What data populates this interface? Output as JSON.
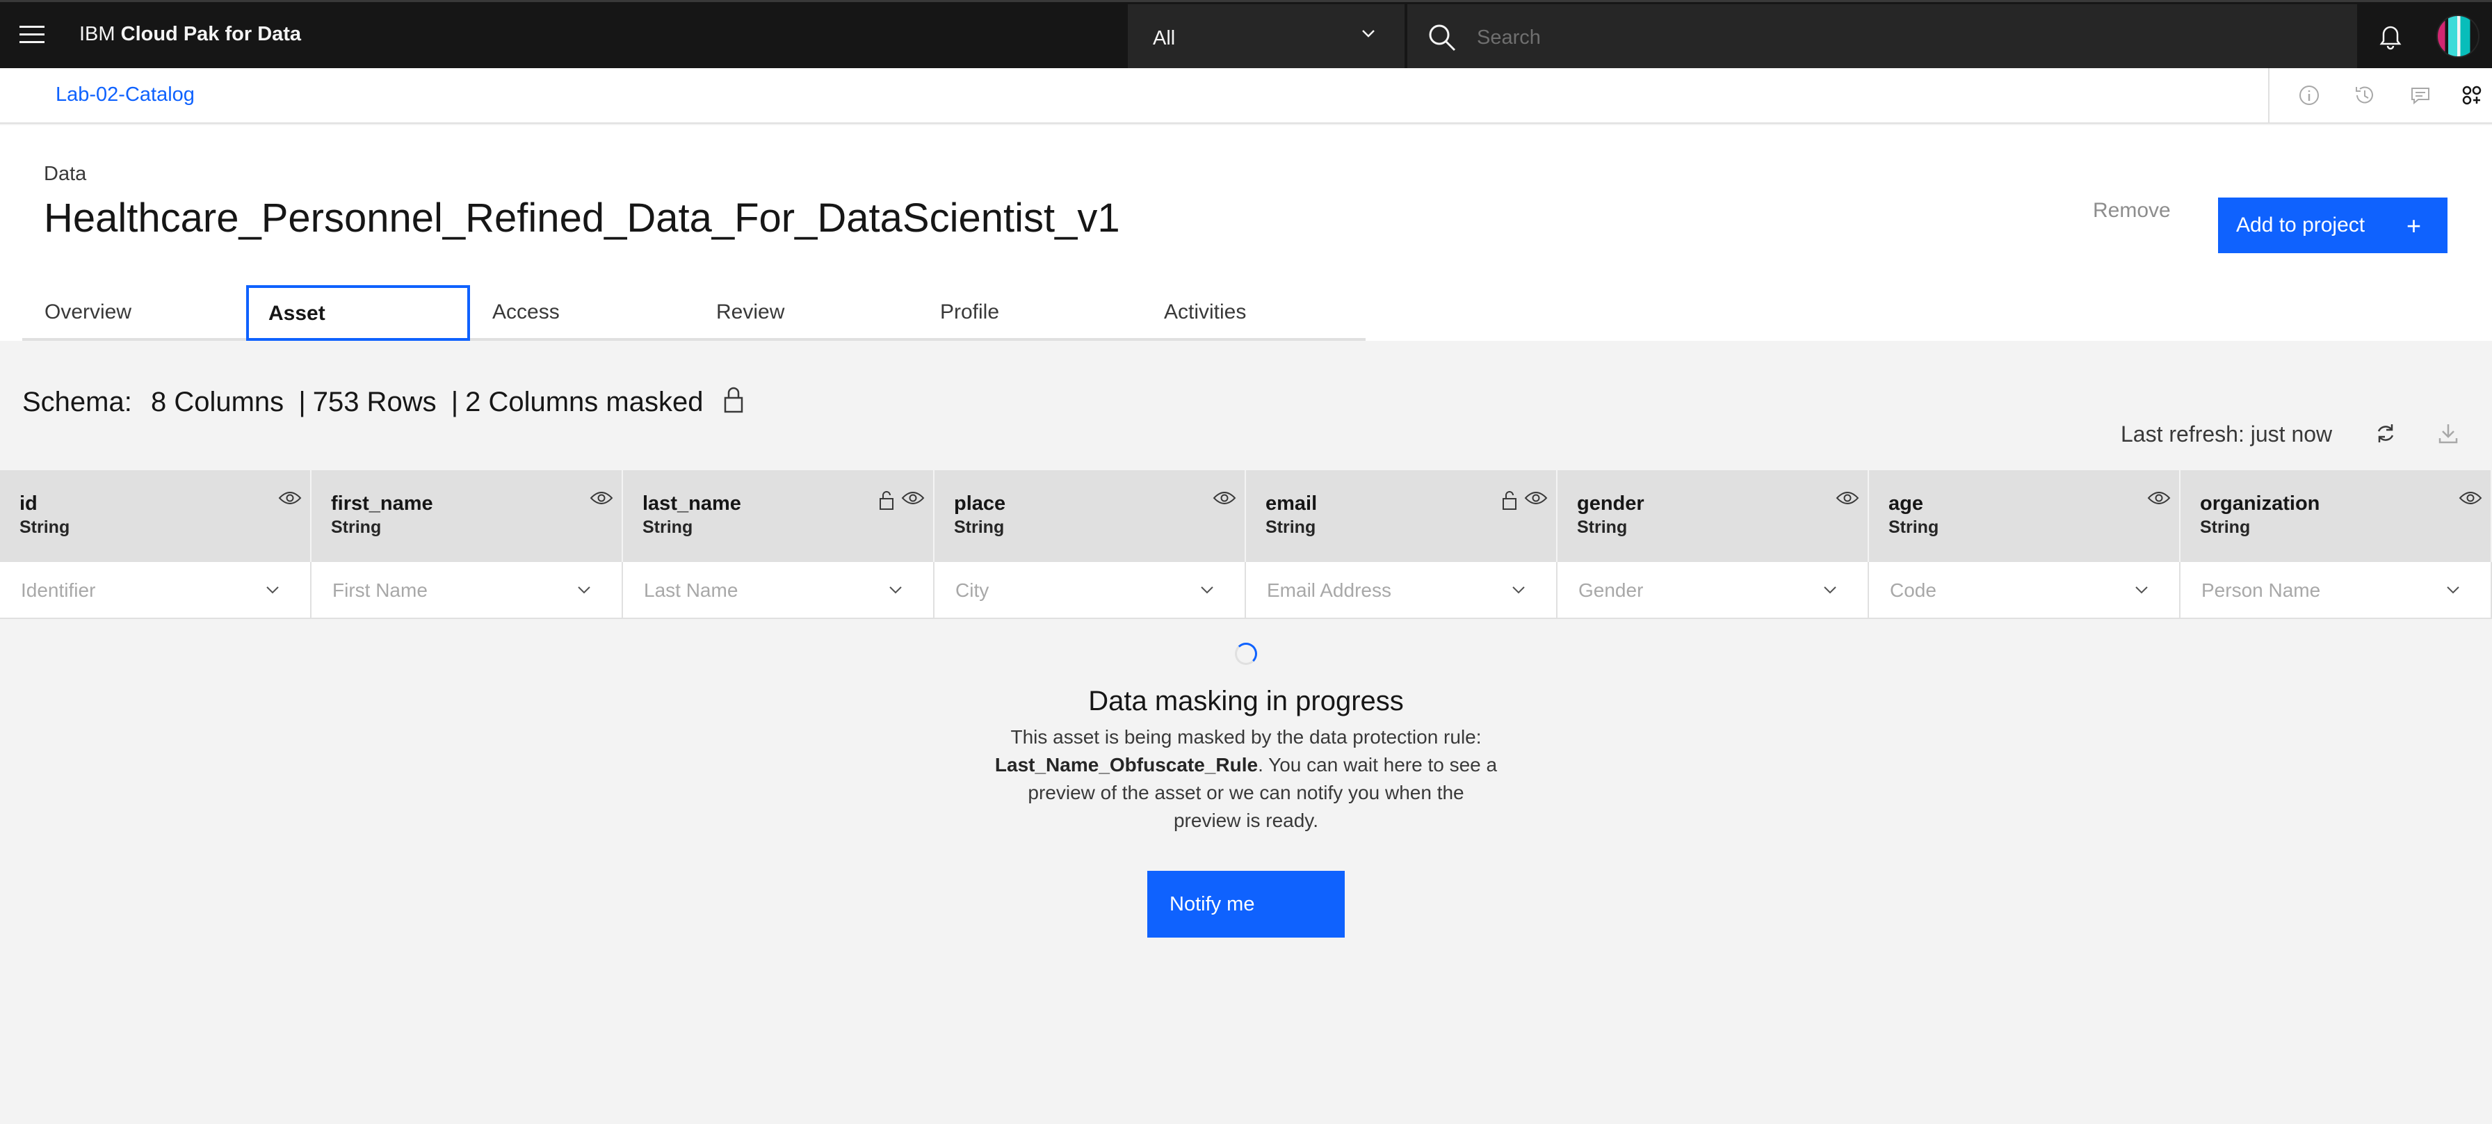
{
  "topbar": {
    "brand_prefix": "IBM",
    "brand_name": "Cloud Pak for Data",
    "scope_value": "All",
    "search_placeholder": "Search"
  },
  "breadcrumb": {
    "link": "Lab-02-Catalog"
  },
  "asset": {
    "type": "Data",
    "title": "Healthcare_Personnel_Refined_Data_For_DataScientist_v1",
    "remove_label": "Remove",
    "add_label": "Add to project",
    "add_icon": "+"
  },
  "tabs": [
    {
      "label": "Overview"
    },
    {
      "label": "Asset",
      "active": true
    },
    {
      "label": "Access"
    },
    {
      "label": "Review"
    },
    {
      "label": "Profile"
    },
    {
      "label": "Activities"
    }
  ],
  "schema": {
    "label": "Schema:",
    "columns": "8 Columns",
    "rows": "753 Rows",
    "masked": "2 Columns masked",
    "separator": "|",
    "last_refresh": "Last refresh: just now"
  },
  "columns": [
    {
      "name": "id",
      "type": "String",
      "term": "Identifier",
      "masked": false
    },
    {
      "name": "first_name",
      "type": "String",
      "term": "First Name",
      "masked": false
    },
    {
      "name": "last_name",
      "type": "String",
      "term": "Last Name",
      "masked": true
    },
    {
      "name": "place",
      "type": "String",
      "term": "City",
      "masked": false
    },
    {
      "name": "email",
      "type": "String",
      "term": "Email Address",
      "masked": true
    },
    {
      "name": "gender",
      "type": "String",
      "term": "Gender",
      "masked": false
    },
    {
      "name": "age",
      "type": "String",
      "term": "Code",
      "masked": false
    },
    {
      "name": "organization",
      "type": "String",
      "term": "Person Name",
      "masked": false
    }
  ],
  "masking": {
    "title": "Data masking in progress",
    "text_before": "This asset is being masked by the data protection rule:",
    "rule": "Last_Name_Obfuscate_Rule",
    "text_after": ". You can wait here to see a preview of the asset or we can notify you when the preview is ready.",
    "notify_label": "Notify me"
  },
  "colors": {
    "accent": "#0f62fe",
    "topbar": "#161616",
    "header_cell": "#e0e0e0"
  },
  "icons": [
    "menu-icon",
    "chevron-down-icon",
    "search-icon",
    "notification-icon",
    "avatar",
    "info-icon",
    "history-icon",
    "comment-icon",
    "apps-icon",
    "lock-icon",
    "eye-icon",
    "refresh-icon",
    "download-icon",
    "spinner-icon"
  ]
}
